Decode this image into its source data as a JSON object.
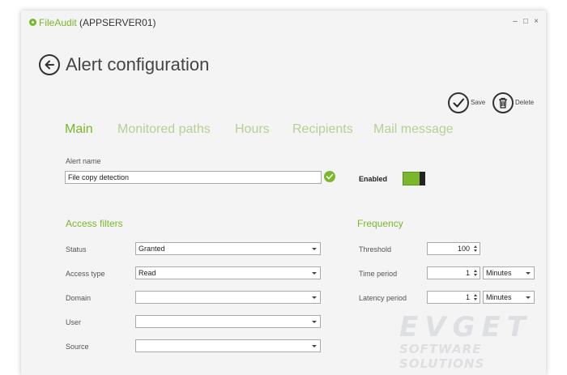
{
  "window": {
    "brand": "FileAudit",
    "server": "(APPSERVER01)",
    "controls": {
      "minimize": "–",
      "maximize": "□",
      "close": "×"
    }
  },
  "page": {
    "title": "Alert configuration"
  },
  "actions": {
    "save_label": "Save",
    "delete_label": "Delete"
  },
  "tabs": [
    {
      "label": "Main",
      "active": true
    },
    {
      "label": "Monitored paths",
      "active": false
    },
    {
      "label": "Hours",
      "active": false
    },
    {
      "label": "Recipients",
      "active": false
    },
    {
      "label": "Mail message",
      "active": false
    }
  ],
  "main": {
    "alert_name_label": "Alert name",
    "alert_name_value": "File copy detection",
    "enabled_label": "Enabled",
    "enabled": true
  },
  "access_filters": {
    "title": "Access filters",
    "status": {
      "label": "Status",
      "value": "Granted"
    },
    "access_type": {
      "label": "Access type",
      "value": "Read"
    },
    "domain": {
      "label": "Domain",
      "value": ""
    },
    "user": {
      "label": "User",
      "value": ""
    },
    "source": {
      "label": "Source",
      "value": ""
    }
  },
  "frequency": {
    "title": "Frequency",
    "threshold": {
      "label": "Threshold",
      "value": "100"
    },
    "time_period": {
      "label": "Time period",
      "value": "1",
      "unit": "Minutes"
    },
    "latency_period": {
      "label": "Latency period",
      "value": "1",
      "unit": "Minutes"
    }
  },
  "watermark": {
    "line1": "EVGET",
    "line2": "SOFTWARE SOLUTIONS"
  },
  "colors": {
    "accent": "#7ab72d",
    "accent_light": "#b7cf95",
    "background": "#f4f4f4"
  },
  "icons": [
    "app-logo-icon",
    "back-arrow-icon",
    "checkmark-icon",
    "trash-icon",
    "check-ok-icon"
  ]
}
